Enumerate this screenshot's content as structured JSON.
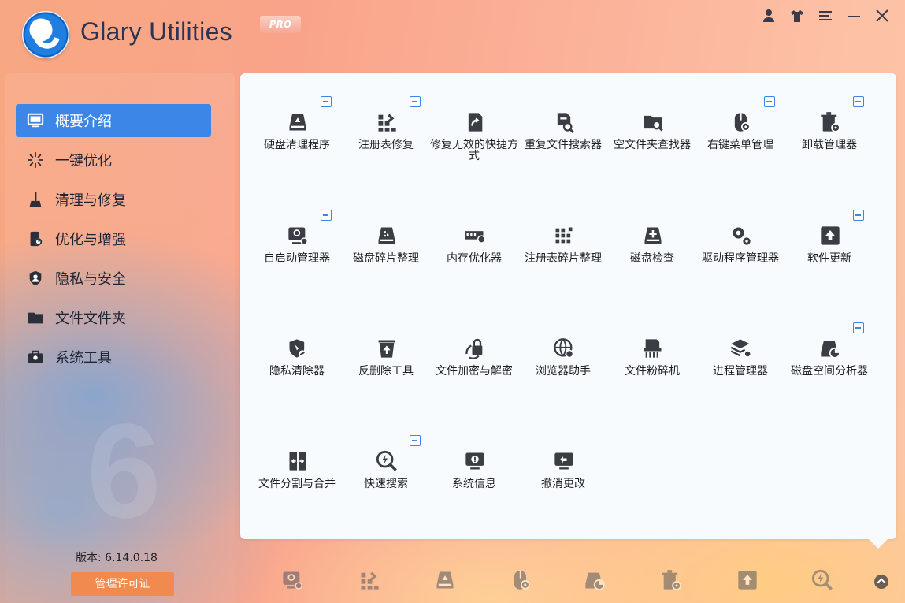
{
  "app": {
    "title": "Glary Utilities",
    "badge": "PRO"
  },
  "window_controls": [
    {
      "name": "account-icon",
      "glyph": "👤"
    },
    {
      "name": "skin-icon",
      "glyph": "👕"
    },
    {
      "name": "menu-icon",
      "glyph": "☰"
    },
    {
      "name": "minimize-icon",
      "glyph": "—"
    },
    {
      "name": "close-icon",
      "glyph": "✕"
    }
  ],
  "sidebar": {
    "items": [
      {
        "label": "概要介绍",
        "icon": "monitor-icon",
        "active": true
      },
      {
        "label": "一键优化",
        "icon": "sparkle-icon",
        "active": false
      },
      {
        "label": "清理与修复",
        "icon": "broom-icon",
        "active": false
      },
      {
        "label": "优化与增强",
        "icon": "gauge-icon",
        "active": false
      },
      {
        "label": "隐私与安全",
        "icon": "shield-icon",
        "active": false
      },
      {
        "label": "文件文件夹",
        "icon": "folder-icon",
        "active": false
      },
      {
        "label": "系统工具",
        "icon": "toolbox-icon",
        "active": false
      }
    ],
    "version": "版本:  6.14.0.18",
    "license_button": "管理许可证",
    "background_digit": "6"
  },
  "tools": [
    {
      "label": "硬盘清理程序",
      "icon": "disk-cleaner-icon",
      "pinned": true
    },
    {
      "label": "注册表修复",
      "icon": "registry-repair-icon",
      "pinned": true
    },
    {
      "label": "修复无效的快捷方式",
      "icon": "shortcut-fixer-icon",
      "pinned": false
    },
    {
      "label": "重复文件搜索器",
      "icon": "duplicate-finder-icon",
      "pinned": false
    },
    {
      "label": "空文件夹查找器",
      "icon": "empty-folder-icon",
      "pinned": false
    },
    {
      "label": "右键菜单管理",
      "icon": "context-menu-icon",
      "pinned": true
    },
    {
      "label": "卸载管理器",
      "icon": "uninstall-icon",
      "pinned": true
    },
    {
      "label": "自启动管理器",
      "icon": "startup-manager-icon",
      "pinned": true
    },
    {
      "label": "磁盘碎片整理",
      "icon": "disk-defrag-icon",
      "pinned": false
    },
    {
      "label": "内存优化器",
      "icon": "memory-optimizer-icon",
      "pinned": false
    },
    {
      "label": "注册表碎片整理",
      "icon": "registry-defrag-icon",
      "pinned": false
    },
    {
      "label": "磁盘检查",
      "icon": "disk-check-icon",
      "pinned": false
    },
    {
      "label": "驱动程序管理器",
      "icon": "driver-manager-icon",
      "pinned": false
    },
    {
      "label": "软件更新",
      "icon": "software-update-icon",
      "pinned": true
    },
    {
      "label": "隐私清除器",
      "icon": "privacy-cleaner-icon",
      "pinned": false
    },
    {
      "label": "反删除工具",
      "icon": "undelete-icon",
      "pinned": false
    },
    {
      "label": "文件加密与解密",
      "icon": "encrypt-icon",
      "pinned": false
    },
    {
      "label": "浏览器助手",
      "icon": "browser-assistant-icon",
      "pinned": false
    },
    {
      "label": "文件粉碎机",
      "icon": "file-shredder-icon",
      "pinned": false
    },
    {
      "label": "进程管理器",
      "icon": "process-manager-icon",
      "pinned": false
    },
    {
      "label": "磁盘空间分析器",
      "icon": "disk-analyzer-icon",
      "pinned": true
    },
    {
      "label": "文件分割与合并",
      "icon": "file-splitter-icon",
      "pinned": false
    },
    {
      "label": "快速搜索",
      "icon": "quick-search-icon",
      "pinned": true
    },
    {
      "label": "系统信息",
      "icon": "system-info-icon",
      "pinned": false
    },
    {
      "label": "撤消更改",
      "icon": "undo-changes-icon",
      "pinned": false
    }
  ],
  "dock": [
    {
      "icon": "startup-manager-icon"
    },
    {
      "icon": "registry-repair-icon"
    },
    {
      "icon": "disk-cleaner-icon"
    },
    {
      "icon": "context-menu-icon"
    },
    {
      "icon": "disk-analyzer-icon"
    },
    {
      "icon": "uninstall-icon"
    },
    {
      "icon": "software-update-icon"
    },
    {
      "icon": "quick-search-icon"
    }
  ],
  "colors": {
    "accent": "#3b86e6",
    "license": "#f08a4e",
    "icon": "#3a3d44"
  }
}
